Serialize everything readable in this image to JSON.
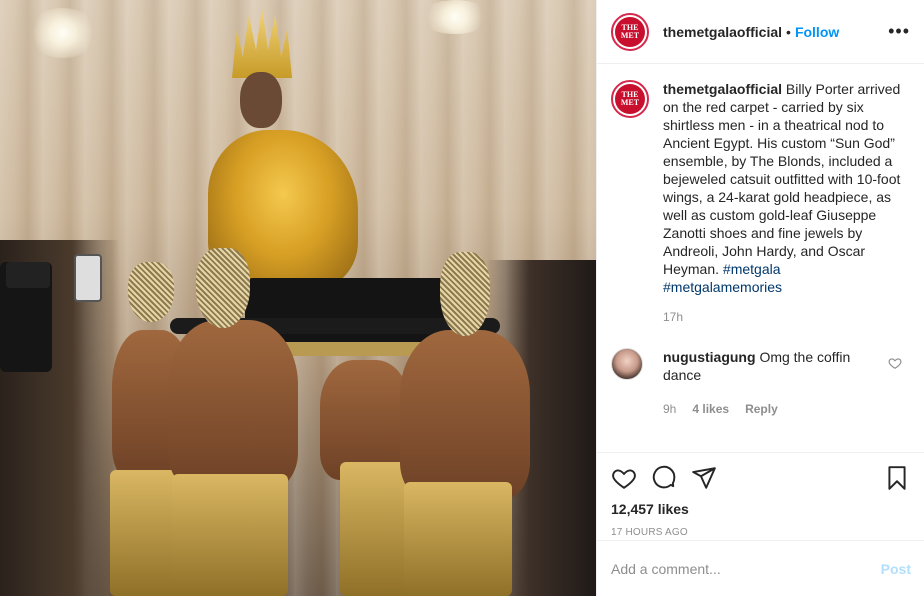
{
  "header": {
    "account": "themetgalaofficial",
    "separator": "•",
    "follow_label": "Follow",
    "more_icon": "more-options-icon",
    "avatar_line1": "THE",
    "avatar_line2": "MET"
  },
  "caption": {
    "user": "themetgalaofficial",
    "text": "Billy Porter arrived on the red carpet - carried by six shirtless men - in a theatrical nod to Ancient Egypt. His custom “Sun God” ensemble, by The Blonds, included a bejeweled catsuit outfitted with 10-foot wings, a 24-karat gold headpiece, as well as custom gold-leaf Giuseppe Zanotti shoes and fine jewels by Andreoli, John Hardy, and Oscar Heyman.",
    "hashtag1": "#metgala",
    "hashtag2": "#metgalamemories",
    "time": "17h"
  },
  "comment": {
    "user": "nugustiagung",
    "text": "Omg the coffin dance",
    "time": "9h",
    "likes": "4 likes",
    "reply": "Reply"
  },
  "actions": {
    "icons": [
      "heart-icon",
      "comment-icon",
      "share-icon",
      "bookmark-icon"
    ],
    "likes": "12,457 likes",
    "posted_ago": "17 HOURS AGO"
  },
  "add_comment": {
    "placeholder": "Add a comment...",
    "post_label": "Post"
  },
  "colors": {
    "follow": "#0095f6",
    "brand_red": "#c8102e",
    "muted": "#8e8e8e",
    "post_disabled": "#b2dffc"
  }
}
